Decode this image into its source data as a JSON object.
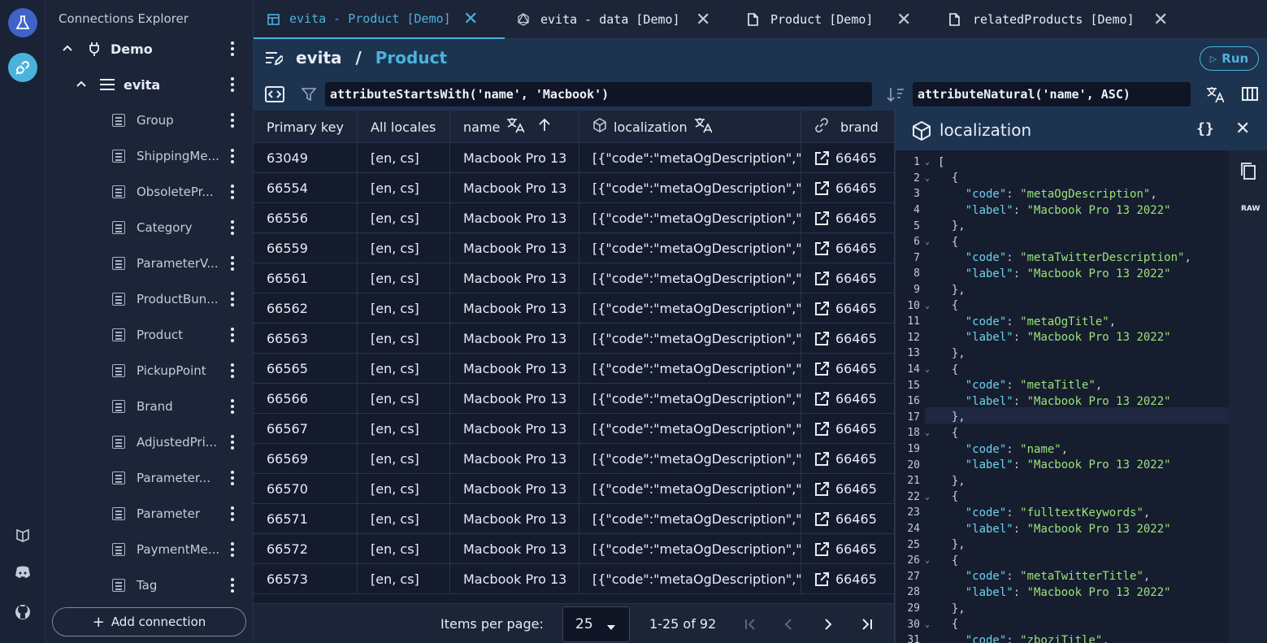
{
  "rail": {
    "top_icon": "flask-icon",
    "active_icon": "plug-icon",
    "bottom_icons": [
      "book-icon",
      "discord-icon",
      "github-icon"
    ]
  },
  "sidebar": {
    "title": "Connections Explorer",
    "connection": "Demo",
    "catalog": "evita",
    "collections": [
      "Group",
      "ShippingMe...",
      "ObsoletePr...",
      "Category",
      "ParameterV...",
      "ProductBun...",
      "Product",
      "PickupPoint",
      "Brand",
      "AdjustedPri...",
      "Parameter...",
      "Parameter",
      "PaymentMe...",
      "Tag"
    ],
    "add_connection": "Add connection"
  },
  "tabs": [
    {
      "label": "evita - Product [Demo]",
      "icon": "grid-icon",
      "active": true
    },
    {
      "label": "evita - data [Demo]",
      "icon": "graphql-icon",
      "active": false
    },
    {
      "label": "Product [Demo]",
      "icon": "file-icon",
      "active": false
    },
    {
      "label": "relatedProducts [Demo]",
      "icon": "file-icon",
      "active": false
    }
  ],
  "toolbar": {
    "catalog": "evita",
    "separator": "/",
    "collection": "Product",
    "run_label": "Run",
    "filter_query": "attributeStartsWith('name', 'Macbook')",
    "order_query": "attributeNatural('name', ASC)"
  },
  "grid": {
    "columns": [
      "Primary key",
      "All locales",
      "name",
      "localization",
      "brand"
    ],
    "rows": [
      [
        "63049",
        "[en, cs]",
        "Macbook Pro 13",
        "[{\"code\":\"metaOgDescription\",\"",
        "66465"
      ],
      [
        "66554",
        "[en, cs]",
        "Macbook Pro 13",
        "[{\"code\":\"metaOgDescription\",\"",
        "66465"
      ],
      [
        "66556",
        "[en, cs]",
        "Macbook Pro 13",
        "[{\"code\":\"metaOgDescription\",\"",
        "66465"
      ],
      [
        "66559",
        "[en, cs]",
        "Macbook Pro 13",
        "[{\"code\":\"metaOgDescription\",\"",
        "66465"
      ],
      [
        "66561",
        "[en, cs]",
        "Macbook Pro 13",
        "[{\"code\":\"metaOgDescription\",\"",
        "66465"
      ],
      [
        "66562",
        "[en, cs]",
        "Macbook Pro 13",
        "[{\"code\":\"metaOgDescription\",\"",
        "66465"
      ],
      [
        "66563",
        "[en, cs]",
        "Macbook Pro 13",
        "[{\"code\":\"metaOgDescription\",\"",
        "66465"
      ],
      [
        "66565",
        "[en, cs]",
        "Macbook Pro 13",
        "[{\"code\":\"metaOgDescription\",\"",
        "66465"
      ],
      [
        "66566",
        "[en, cs]",
        "Macbook Pro 13",
        "[{\"code\":\"metaOgDescription\",\"",
        "66465"
      ],
      [
        "66567",
        "[en, cs]",
        "Macbook Pro 13",
        "[{\"code\":\"metaOgDescription\",\"",
        "66465"
      ],
      [
        "66569",
        "[en, cs]",
        "Macbook Pro 13",
        "[{\"code\":\"metaOgDescription\",\"",
        "66465"
      ],
      [
        "66570",
        "[en, cs]",
        "Macbook Pro 13",
        "[{\"code\":\"metaOgDescription\",\"",
        "66465"
      ],
      [
        "66571",
        "[en, cs]",
        "Macbook Pro 13",
        "[{\"code\":\"metaOgDescription\",\"",
        "66465"
      ],
      [
        "66572",
        "[en, cs]",
        "Macbook Pro 13",
        "[{\"code\":\"metaOgDescription\",\"",
        "66465"
      ],
      [
        "66573",
        "[en, cs]",
        "Macbook Pro 13",
        "[{\"code\":\"metaOgDescription\",\"",
        "66465"
      ]
    ]
  },
  "pager": {
    "items_per_page_label": "Items per page:",
    "items_per_page": "25",
    "range": "1-25 of 92"
  },
  "detail": {
    "title": "localization",
    "raw_label": "RAW",
    "json_lines": [
      "[",
      "  {",
      "    \"code\": \"metaOgDescription\",",
      "    \"label\": \"Macbook Pro 13 2022\"",
      "  },",
      "  {",
      "    \"code\": \"metaTwitterDescription\",",
      "    \"label\": \"Macbook Pro 13 2022\"",
      "  },",
      "  {",
      "    \"code\": \"metaOgTitle\",",
      "    \"label\": \"Macbook Pro 13 2022\"",
      "  },",
      "  {",
      "    \"code\": \"metaTitle\",",
      "    \"label\": \"Macbook Pro 13 2022\"",
      "  },",
      "  {",
      "    \"code\": \"name\",",
      "    \"label\": \"Macbook Pro 13 2022\"",
      "  },",
      "  {",
      "    \"code\": \"fulltextKeywords\",",
      "    \"label\": \"Macbook Pro 13 2022\"",
      "  },",
      "  {",
      "    \"code\": \"metaTwitterTitle\",",
      "    \"label\": \"Macbook Pro 13 2022\"",
      "  },",
      "  {",
      "    \"code\": \"zboziTitle\","
    ]
  },
  "colors": {
    "accent": "#4ab3dc",
    "background": "#141b2d",
    "toolbar": "#1d3450"
  }
}
